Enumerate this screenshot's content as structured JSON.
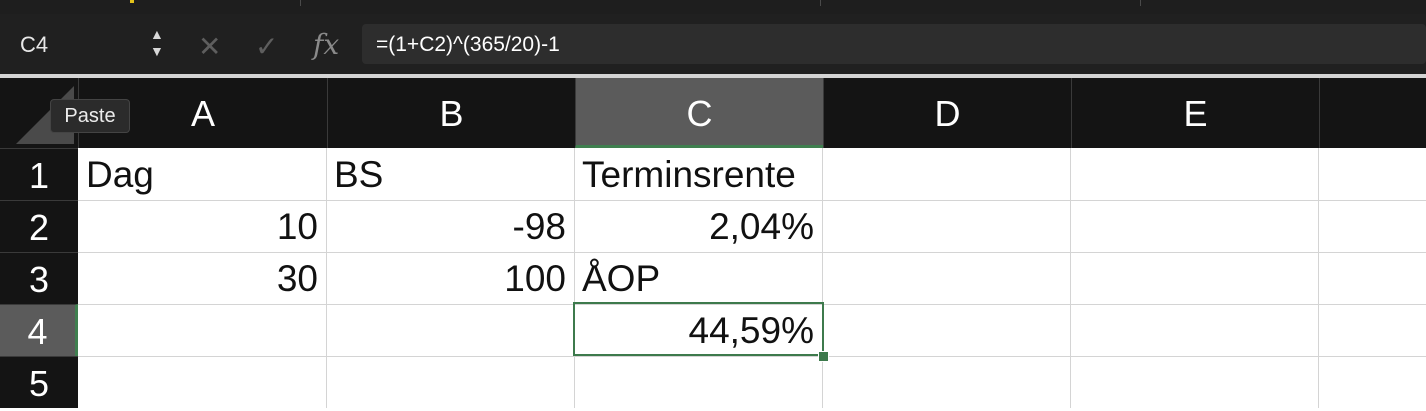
{
  "formula_bar": {
    "name_box": "C4",
    "cancel_icon": "close-icon",
    "enter_icon": "check-icon",
    "fx_label": "fx",
    "formula": "=(1+C2)^(365/20)-1"
  },
  "tooltip": {
    "text": "Paste"
  },
  "columns": [
    "A",
    "B",
    "C",
    "D",
    "E"
  ],
  "rows": [
    "1",
    "2",
    "3",
    "4",
    "5"
  ],
  "selected": {
    "column": "C",
    "row": "4"
  },
  "cells": {
    "A1": "Dag",
    "B1": "BS",
    "C1": "Terminsrente",
    "A2": "10",
    "B2": "-98",
    "C2": "2,04%",
    "A3": "30",
    "B3": "100",
    "C3": "ÅOP",
    "C4": "44,59%"
  },
  "colors": {
    "selection": "#3d7a4c",
    "header_bg": "#141414",
    "selected_header_bg": "#5b5b5b"
  }
}
